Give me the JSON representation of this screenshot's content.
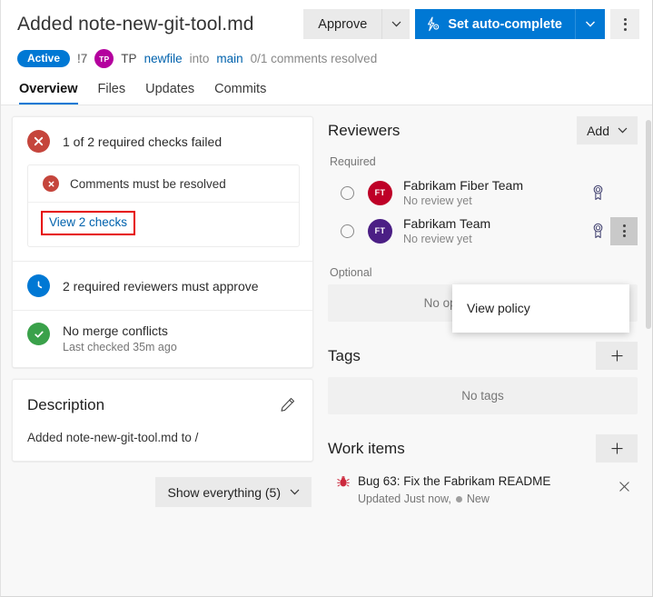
{
  "header": {
    "title": "Added note-new-git-tool.md",
    "approve_label": "Approve",
    "autocomplete_label": "Set auto-complete",
    "autocomplete_icon": "auto-complete-icon",
    "more_icon": "more-actions-icon",
    "caret_icon": "chevron-down-icon",
    "accent_color": "#0078d4"
  },
  "meta": {
    "status": "Active",
    "status_color": "#0078d4",
    "pr_id": "!7",
    "author_initials": "TP",
    "author_avatar_color": "#b4009e",
    "author": "TP",
    "source_branch": "newfile",
    "into_word": "into",
    "target_branch": "main",
    "comments": "0/1 comments resolved"
  },
  "tabs": [
    {
      "label": "Overview",
      "active": true
    },
    {
      "label": "Files",
      "active": false
    },
    {
      "label": "Updates",
      "active": false
    },
    {
      "label": "Commits",
      "active": false
    }
  ],
  "checks": {
    "summary": "1 of 2 required checks failed",
    "summary_icon": "error-circle-icon",
    "summary_icon_color": "#c5453c",
    "failed_check": "Comments must be resolved",
    "failed_check_icon": "error-circle-icon",
    "view_checks_link": "View 2 checks",
    "highlight_color": "#e60000",
    "rows": [
      {
        "icon": "clock-icon",
        "icon_color": "#0078d4",
        "title": "2 required reviewers must approve",
        "subtitle": ""
      },
      {
        "icon": "check-circle-icon",
        "icon_color": "#3aa14a",
        "title": "No merge conflicts",
        "subtitle": "Last checked 35m ago"
      }
    ]
  },
  "description": {
    "title": "Description",
    "edit_icon": "pencil-icon",
    "text": "Added note-new-git-tool.md to /"
  },
  "show_everything": {
    "label": "Show everything (5)",
    "caret_icon": "chevron-down-icon"
  },
  "reviewers": {
    "title": "Reviewers",
    "add_label": "Add",
    "add_caret_icon": "chevron-down-icon",
    "required_label": "Required",
    "optional_label": "Optional",
    "optional_empty": "No optional reviewers",
    "items": [
      {
        "name": "Fabrikam Fiber Team",
        "status": "No review yet",
        "initials": "FT",
        "avatar_color": "#be0027",
        "vote_icon": "vote-radio-icon",
        "policy_icon": "policy-ribbon-icon",
        "has_kebab": false
      },
      {
        "name": "Fabrikam Team",
        "status": "No review yet",
        "initials": "FT",
        "avatar_color": "#4b1f85",
        "vote_icon": "vote-radio-icon",
        "policy_icon": "policy-ribbon-icon",
        "has_kebab": true
      }
    ]
  },
  "context_menu": {
    "items": [
      {
        "label": "View policy"
      }
    ]
  },
  "tags": {
    "title": "Tags",
    "add_icon": "plus-icon",
    "empty": "No tags"
  },
  "work_items": {
    "title": "Work items",
    "add_icon": "plus-icon",
    "items": [
      {
        "icon": "bug-icon",
        "icon_color": "#cc293d",
        "title": "Bug 63: Fix the Fabrikam README",
        "updated": "Updated Just now,",
        "state": "New",
        "state_dot_color": "#9e9e9e",
        "remove_icon": "close-icon"
      }
    ]
  }
}
